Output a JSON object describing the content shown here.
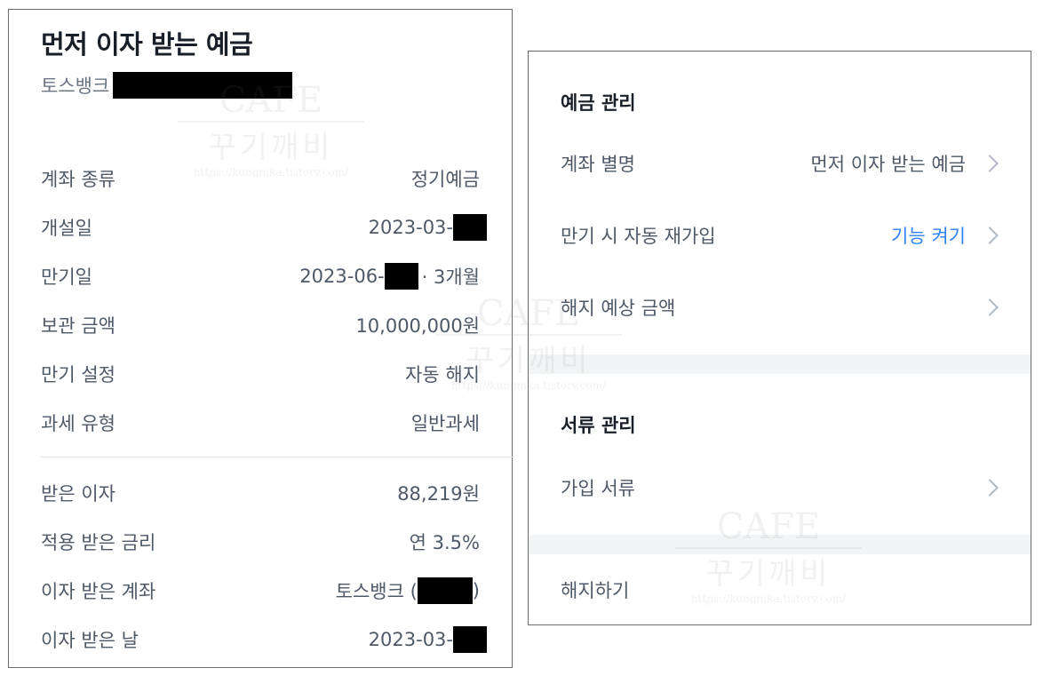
{
  "left": {
    "title": "먼저 이자 받는 예금",
    "bank": "토스뱅크",
    "details": [
      {
        "label": "계좌 종류",
        "value": "정기예금"
      },
      {
        "label": "개설일",
        "value": "2023-03-"
      },
      {
        "label": "만기일",
        "value": "2023-06-",
        "suffix": "· 3개월"
      },
      {
        "label": "보관 금액",
        "value": "10,000,000원"
      },
      {
        "label": "만기 설정",
        "value": "자동 해지"
      },
      {
        "label": "과세 유형",
        "value": "일반과세"
      }
    ],
    "interest": [
      {
        "label": "받은 이자",
        "value": "88,219원"
      },
      {
        "label": "적용 받은 금리",
        "value": "연 3.5%"
      },
      {
        "label": "이자 받은 계좌",
        "value": "토스뱅크 (",
        "suffix": ")"
      },
      {
        "label": "이자 받은 날",
        "value": "2023-03-"
      }
    ]
  },
  "right": {
    "deposit_section": {
      "title": "예금 관리",
      "items": [
        {
          "label": "계좌 별명",
          "value": "먼저 이자 받는 예금"
        },
        {
          "label": "만기 시 자동 재가입",
          "value": "기능 켜기"
        },
        {
          "label": "해지 예상 금액",
          "value": ""
        }
      ]
    },
    "docs_section": {
      "title": "서류 관리",
      "items": [
        {
          "label": "가입 서류"
        }
      ]
    },
    "close_label": "해지하기"
  },
  "watermark": {
    "line1": "CAFE",
    "line2": "꾸기깨비",
    "line3": "https://kungmka.tistory.com/"
  },
  "colors": {
    "accent": "#3182f6",
    "text": "#4e5968",
    "title": "#191f28",
    "band": "#f2f4f6"
  }
}
